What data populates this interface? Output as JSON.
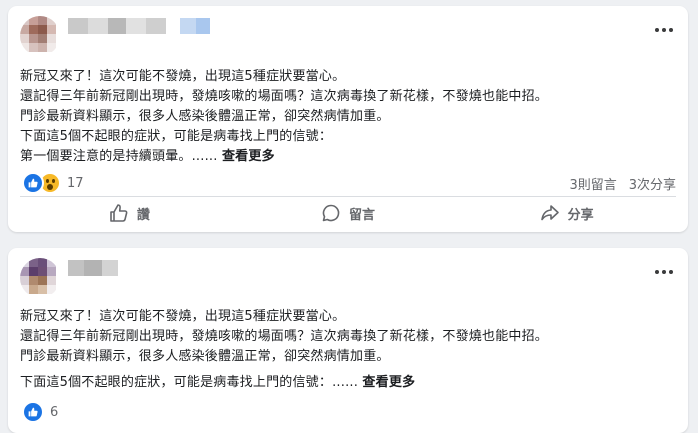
{
  "posts": [
    {
      "text_lines": [
        "新冠又來了！這次可能不發燒，出現這5種症狀要當心。",
        "還記得三年前新冠剛出現時，發燒咳嗽的場面嗎？這次病毒換了新花樣，不發燒也能中招。",
        "門診最新資料顯示，很多人感染後體溫正常，卻突然病情加重。",
        "下面這5個不起眼的症狀，可能是病毒找上門的信號："
      ],
      "last_line": "第一個要注意的是持續頭暈。......",
      "see_more": "查看更多",
      "reactions": {
        "icons": [
          "like-icon",
          "wow-icon"
        ],
        "count": "17"
      },
      "comments": "3則留言",
      "shares": "3次分享",
      "actions": {
        "like": "讚",
        "comment": "留言",
        "share": "分享"
      }
    },
    {
      "text_lines": [
        "新冠又來了！這次可能不發燒，出現這5種症狀要當心。",
        "還記得三年前新冠剛出現時，發燒咳嗽的場面嗎？這次病毒換了新花樣，不發燒也能中招。",
        "門診最新資料顯示，很多人感染後體溫正常，卻突然病情加重。"
      ],
      "last_line": "下面這5個不起眼的症狀，可能是病毒找上門的信號：......",
      "see_more": "查看更多",
      "reactions": {
        "icons": [
          "like-icon"
        ],
        "count": "6"
      }
    }
  ],
  "colors": {
    "accent": "#1b74e4",
    "muted": "#65676b",
    "background": "#eef0f3"
  }
}
